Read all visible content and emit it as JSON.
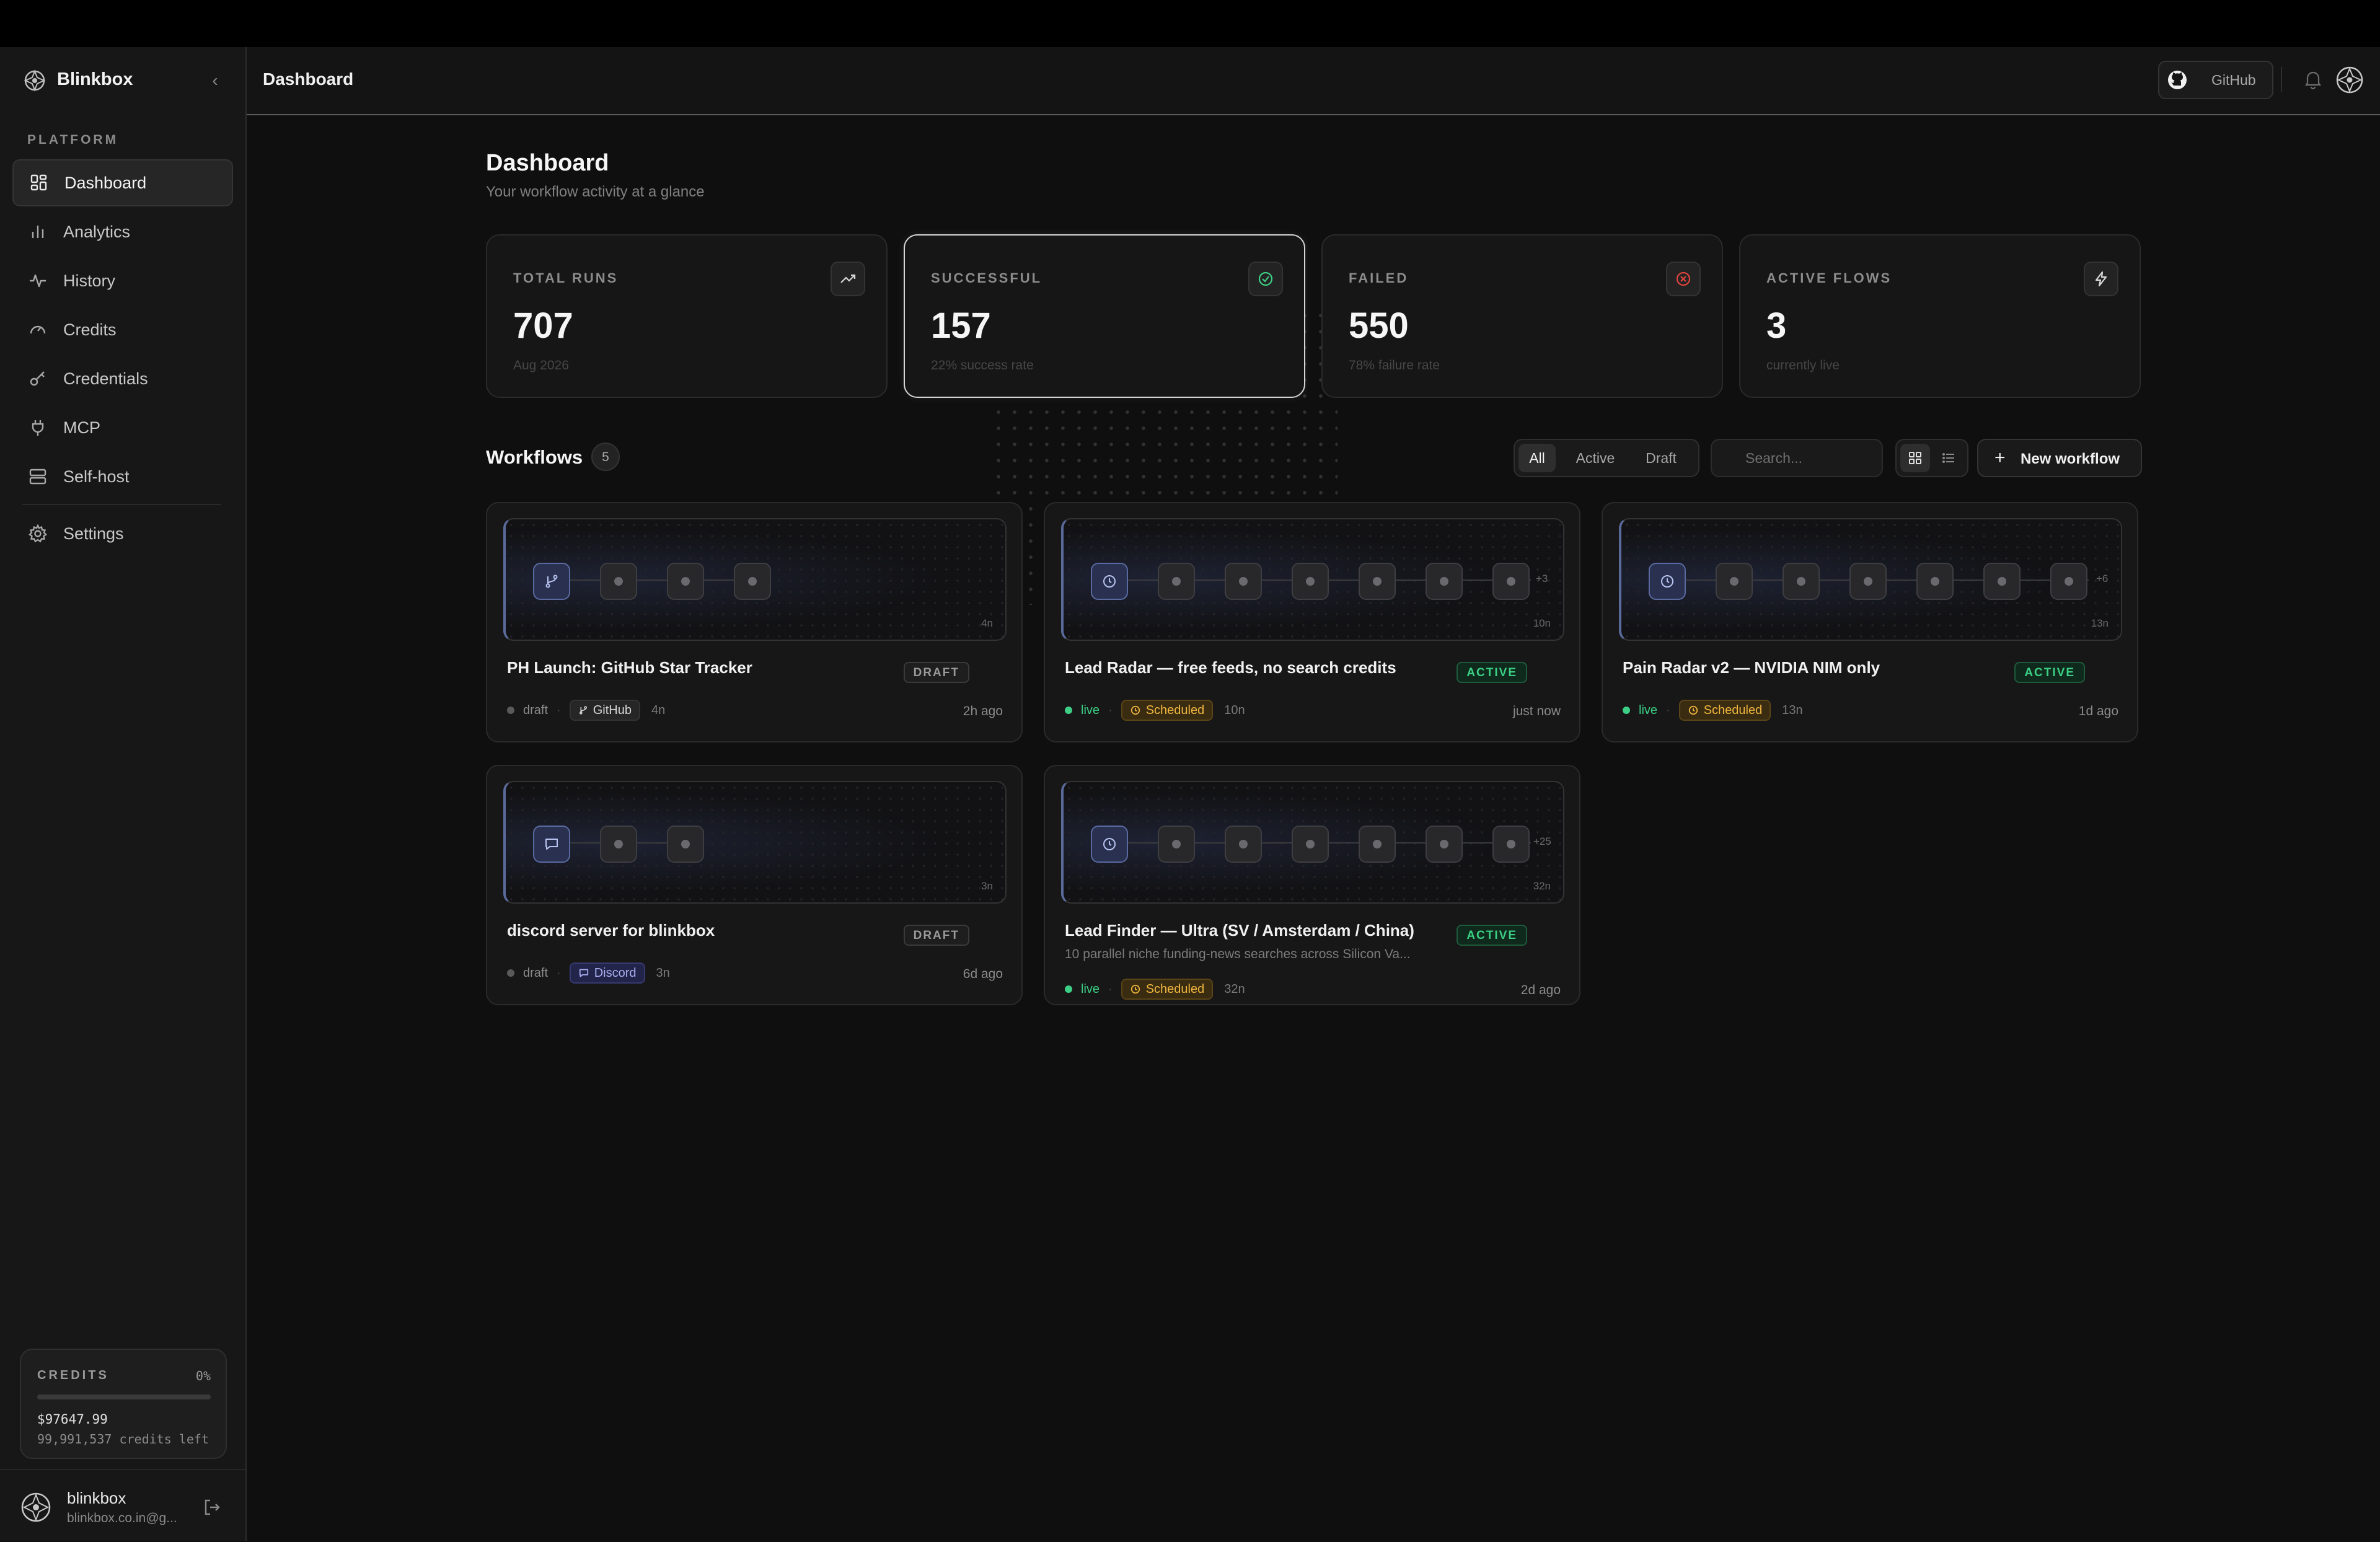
{
  "app": {
    "name": "Blinkbox"
  },
  "sidebar": {
    "section_label": "PLATFORM",
    "items": [
      {
        "label": "Dashboard",
        "icon": "dashboard-icon",
        "active": true
      },
      {
        "label": "Analytics",
        "icon": "analytics-icon"
      },
      {
        "label": "History",
        "icon": "activity-icon"
      },
      {
        "label": "Credits",
        "icon": "gauge-icon"
      },
      {
        "label": "Credentials",
        "icon": "key-icon"
      },
      {
        "label": "MCP",
        "icon": "plug-icon"
      },
      {
        "label": "Self-host",
        "icon": "server-icon"
      },
      {
        "label": "Settings",
        "icon": "gear-icon"
      }
    ],
    "credits": {
      "label": "CREDITS",
      "percent": "0%",
      "amount": "$97647.99",
      "left": "99,991,537 credits left"
    },
    "user": {
      "name": "blinkbox",
      "email": "blinkbox.co.in@g..."
    }
  },
  "header": {
    "title": "Dashboard",
    "github_label": "GitHub"
  },
  "page": {
    "title": "Dashboard",
    "subtitle": "Your workflow activity at a glance"
  },
  "stats": [
    {
      "label": "TOTAL RUNS",
      "value": "707",
      "sub": "Aug 2026",
      "icon": "trending-up-icon"
    },
    {
      "label": "SUCCESSFUL",
      "value": "157",
      "sub": "22% success rate",
      "icon": "check-circle-icon",
      "color": "#3ccf85"
    },
    {
      "label": "FAILED",
      "value": "550",
      "sub": "78% failure rate",
      "icon": "x-circle-icon",
      "color": "#e0443e"
    },
    {
      "label": "ACTIVE FLOWS",
      "value": "3",
      "sub": "currently live",
      "icon": "bolt-icon"
    }
  ],
  "workflows": {
    "title": "Workflows",
    "count": "5",
    "filters": [
      "All",
      "Active",
      "Draft"
    ],
    "active_filter": "All",
    "search_placeholder": "Search...",
    "new_label": "New workflow",
    "cards": [
      {
        "title": "PH Launch: GitHub Star Tracker",
        "description": "",
        "status": "DRAFT",
        "state": "draft",
        "trigger": "GitHub",
        "trigger_icon": "git-branch-icon",
        "nodes": "4n",
        "more": "",
        "time": "2h ago"
      },
      {
        "title": "Lead Radar — free feeds, no search credits",
        "description": "",
        "status": "ACTIVE",
        "state": "live",
        "trigger": "Scheduled",
        "trigger_icon": "clock-icon",
        "nodes": "10n",
        "more": "+3",
        "time": "just now"
      },
      {
        "title": "Pain Radar v2 — NVIDIA NIM only",
        "description": "",
        "status": "ACTIVE",
        "state": "live",
        "trigger": "Scheduled",
        "trigger_icon": "clock-icon",
        "nodes": "13n",
        "more": "+6",
        "time": "1d ago"
      },
      {
        "title": "discord server for blinkbox",
        "description": "",
        "status": "DRAFT",
        "state": "draft",
        "trigger": "Discord",
        "trigger_icon": "message-icon",
        "nodes": "3n",
        "more": "",
        "time": "6d ago"
      },
      {
        "title": "Lead Finder — Ultra (SV / Amsterdam / China)",
        "description": "10 parallel niche funding-news searches across Silicon Va...",
        "status": "ACTIVE",
        "state": "live",
        "trigger": "Scheduled",
        "trigger_icon": "clock-icon",
        "nodes": "32n",
        "more": "+25",
        "time": "2d ago"
      }
    ]
  },
  "colors": {
    "accent_green": "#3ccf85",
    "accent_red": "#e0443e",
    "scheduled": "#f0b640",
    "discord": "#a8aef0"
  }
}
